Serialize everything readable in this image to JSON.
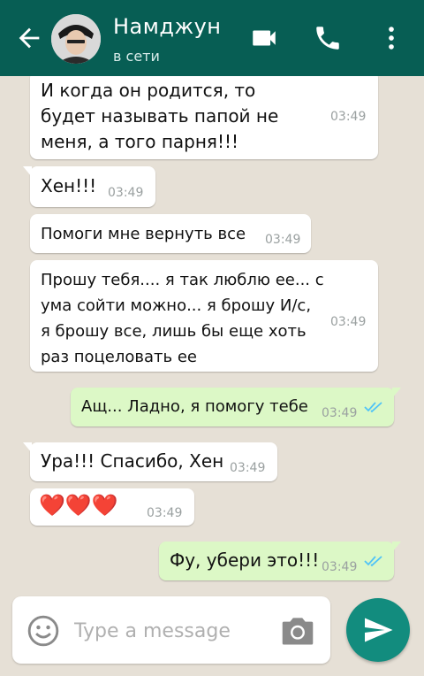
{
  "header": {
    "contact_name": "Намджун",
    "status": "в сети",
    "icons": [
      "back-arrow-icon",
      "video-call-icon",
      "phone-icon",
      "more-options-icon"
    ],
    "color": "#075e54"
  },
  "messages": [
    {
      "direction": "in",
      "text": "И когда он родится, то будет называть папой не меня, а того парня!!!",
      "time": "03:49"
    },
    {
      "direction": "in",
      "text": "Хен!!!",
      "time": "03:49"
    },
    {
      "direction": "in",
      "text": "Помоги мне вернуть все",
      "time": "03:49"
    },
    {
      "direction": "in",
      "text": "Прошу тебя.... я так люблю ее... с ума сойти можно... я брошу И/с, я брошу все, лишь бы еще хоть раз поцеловать ее",
      "time": "03:49"
    },
    {
      "direction": "out",
      "text": "Ащ... Ладно, я помогу тебе",
      "time": "03:49",
      "status": "read"
    },
    {
      "direction": "in",
      "text": "Ура!!! Спасибо, Хен",
      "time": "03:49"
    },
    {
      "direction": "in",
      "text": "❤️❤️❤️",
      "time": "03:49"
    },
    {
      "direction": "out",
      "text": "Фу, убери это!!!",
      "time": "03:49",
      "status": "read"
    }
  ],
  "composer": {
    "placeholder": "Type a message",
    "icons": [
      "emoji-icon",
      "camera-icon",
      "send-icon"
    ]
  },
  "colors": {
    "incoming_bubble": "#ffffff",
    "outgoing_bubble": "#dcf8c6",
    "chat_background": "#e6e0d6",
    "read_ticks": "#4fc3f7",
    "send_button": "#128c7e"
  }
}
